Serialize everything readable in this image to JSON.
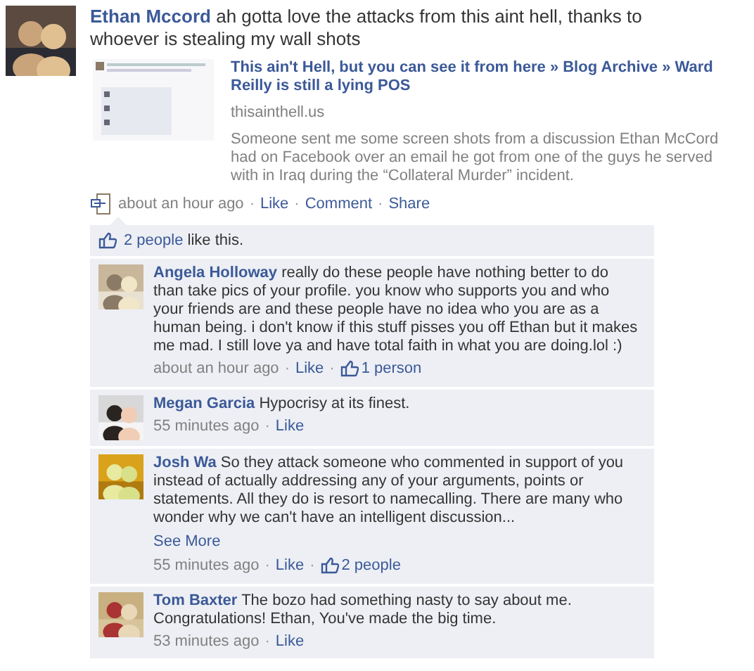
{
  "post": {
    "author": "Ethan Mccord",
    "text": "ah gotta love the attacks from this aint hell, thanks to whoever is stealing my wall shots",
    "link": {
      "title": "This ain't Hell, but you can see it from here » Blog Archive » Ward Reilly is still a lying POS",
      "domain": "thisainthell.us",
      "description": "Someone sent me some screen shots from a discussion Ethan McCord had on Facebook over an email he got from one of the guys he served with in Iraq during the “Collateral Murder” incident."
    },
    "time": "about an hour ago",
    "separator": "·",
    "actions": [
      "Like",
      "Comment",
      "Share"
    ]
  },
  "likes": {
    "link": "2 people",
    "text": "like this."
  },
  "comments": [
    {
      "author": "Angela Holloway",
      "text": "really do these people have nothing better to do than take pics of your profile. you know who supports you and who your friends are and these people have no idea who you are as a human being. i don't know if this stuff pisses you off Ethan but it makes me mad. I still love ya and have total faith in what you are doing.lol :)",
      "time": "about an hour ago",
      "like": "Like",
      "like_count": "1 person"
    },
    {
      "author": "Megan Garcia",
      "text": "Hypocrisy at its finest.",
      "time": "55 minutes ago",
      "like": "Like"
    },
    {
      "author": "Josh Wa",
      "text": "So they attack someone who commented in support of you instead of actually addressing any of your arguments, points or statements. All they do is resort to namecalling. There are many who wonder why we can't have an intelligent discussion...",
      "see_more": "See More",
      "time": "55 minutes ago",
      "like": "Like",
      "like_count": "2 people"
    },
    {
      "author": "Tom Baxter",
      "text": "The bozo had something nasty to say about me. Congratulations! Ethan, You've made the big time.",
      "time": "53 minutes ago",
      "like": "Like"
    }
  ]
}
